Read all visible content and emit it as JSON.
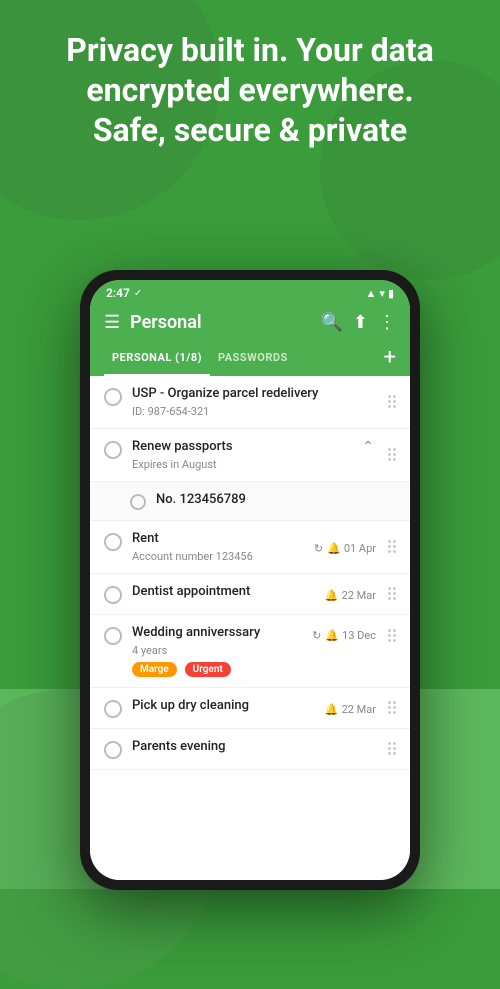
{
  "hero": {
    "text": "Privacy built in. Your data encrypted everywhere.\nSafe, secure & private"
  },
  "status_bar": {
    "time": "2:47",
    "check": "✓"
  },
  "app_bar": {
    "title": "Personal",
    "menu_icon": "☰",
    "search_icon": "🔍",
    "share_icon": "⬆",
    "more_icon": "⋮"
  },
  "tabs": [
    {
      "label": "PERSONAL (1/8)",
      "active": true
    },
    {
      "label": "PASSWORDS",
      "active": false
    }
  ],
  "add_button": "+",
  "tasks": [
    {
      "id": 1,
      "title": "USP - Organize parcel redelivery",
      "subtitle": "ID: 987-654-321",
      "date": null,
      "repeat": null,
      "tags": [],
      "sub_items": []
    },
    {
      "id": 2,
      "title": "Renew passports",
      "subtitle": "Expires in August",
      "date": null,
      "repeat": null,
      "tags": [],
      "sub_items": [
        {
          "title": "No. 123456789"
        }
      ],
      "collapsed": false
    },
    {
      "id": 3,
      "title": "Rent",
      "subtitle": "Account number 123456",
      "date": "01 Apr",
      "repeat": "↺",
      "tags": []
    },
    {
      "id": 4,
      "title": "Dentist appointment",
      "subtitle": "",
      "date": "22 Mar",
      "repeat": null,
      "tags": []
    },
    {
      "id": 5,
      "title": "Wedding anniverssary",
      "subtitle": "4 years",
      "date": "13 Dec",
      "repeat": "↺",
      "tags": [
        "Marge",
        "Urgent"
      ]
    },
    {
      "id": 6,
      "title": "Pick up dry cleaning",
      "subtitle": "",
      "date": "22 Mar",
      "repeat": null,
      "tags": []
    },
    {
      "id": 7,
      "title": "Parents evening",
      "subtitle": "",
      "date": null,
      "repeat": null,
      "tags": []
    }
  ]
}
